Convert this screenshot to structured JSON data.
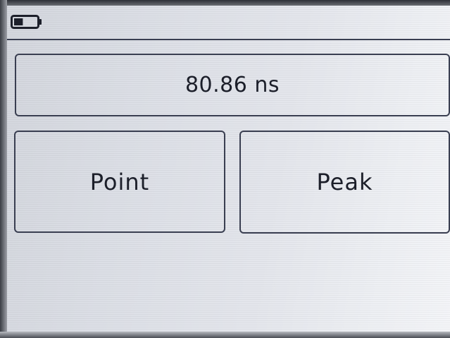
{
  "status_bar": {
    "battery_icon": "battery-low-icon",
    "battery_level": 0.4
  },
  "readout": {
    "value": "80.86 ns"
  },
  "buttons": {
    "point_label": "Point",
    "peak_label": "Peak"
  },
  "colors": {
    "ink": "#1c1f2a",
    "border": "#3a3f52",
    "screen_background": "#dcdfe6"
  }
}
